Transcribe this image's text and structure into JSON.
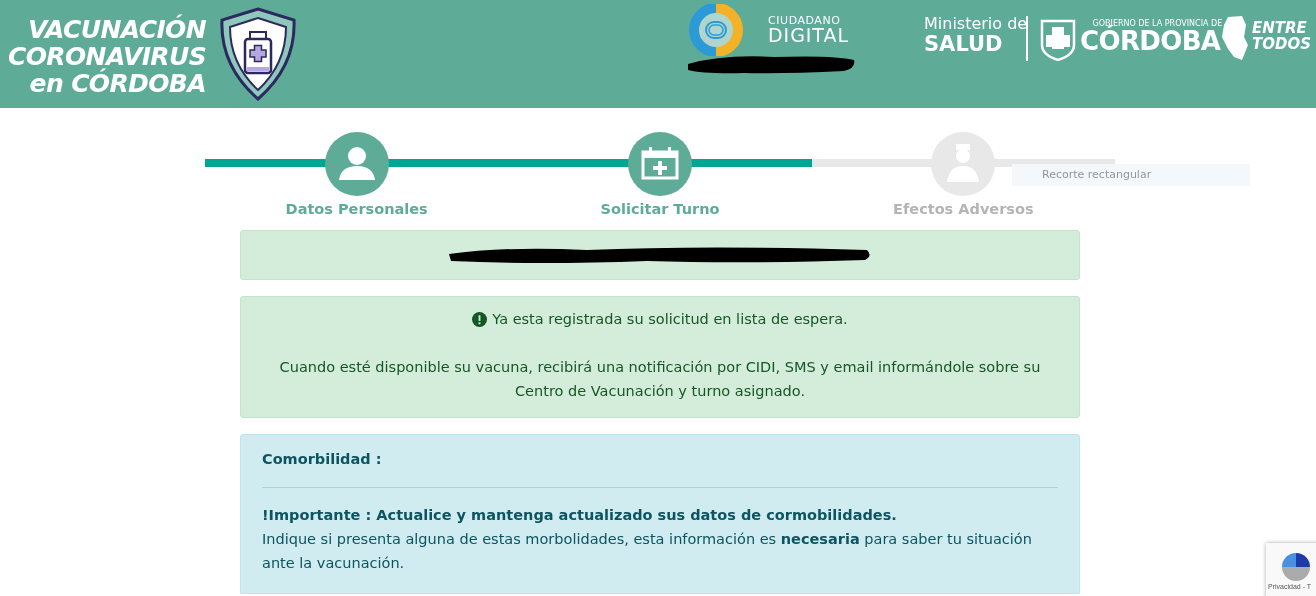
{
  "header": {
    "title_lines": [
      "VACUNACIÓN",
      "CORONAVIRUS",
      "en CÓRDOBA"
    ],
    "cidi": {
      "line1": "CIUDADANO",
      "line2": "DIGITAL"
    },
    "ministry": {
      "line1": "Ministerio de",
      "line2": "SALUD"
    },
    "province": {
      "small": "GOBIERNO DE LA PROVINCIA DE",
      "big": "CÓRDOBA"
    },
    "slogan": {
      "line1": "ENTRE",
      "line2": "TODOS"
    }
  },
  "steps": [
    {
      "label": "Datos Personales",
      "kind": "person",
      "enabled": true
    },
    {
      "label": "Solicitar Turno",
      "kind": "calendar",
      "enabled": true
    },
    {
      "label": "Efectos Adversos",
      "kind": "doctor",
      "enabled": false
    }
  ],
  "snip_tooltip": "Recorte rectangular",
  "alerts": {
    "status": "Ya esta registrada su solicitud en lista de espera.",
    "detail": "Cuando esté disponible su vacuna, recibirá una notificación por CIDI, SMS y email informándole sobre su Centro de Vacunación y turno asignado."
  },
  "comorbidity": {
    "title": "Comorbilidad :",
    "important": "!Importante : Actualice y mantenga actualizado sus datos de cormobilidades.",
    "text": "Indique si presenta alguna de estas morbolidades, esta información es **necesaria** para saber tu situación ante la vacunación."
  },
  "captcha": {
    "text": "Privacidad - T"
  }
}
